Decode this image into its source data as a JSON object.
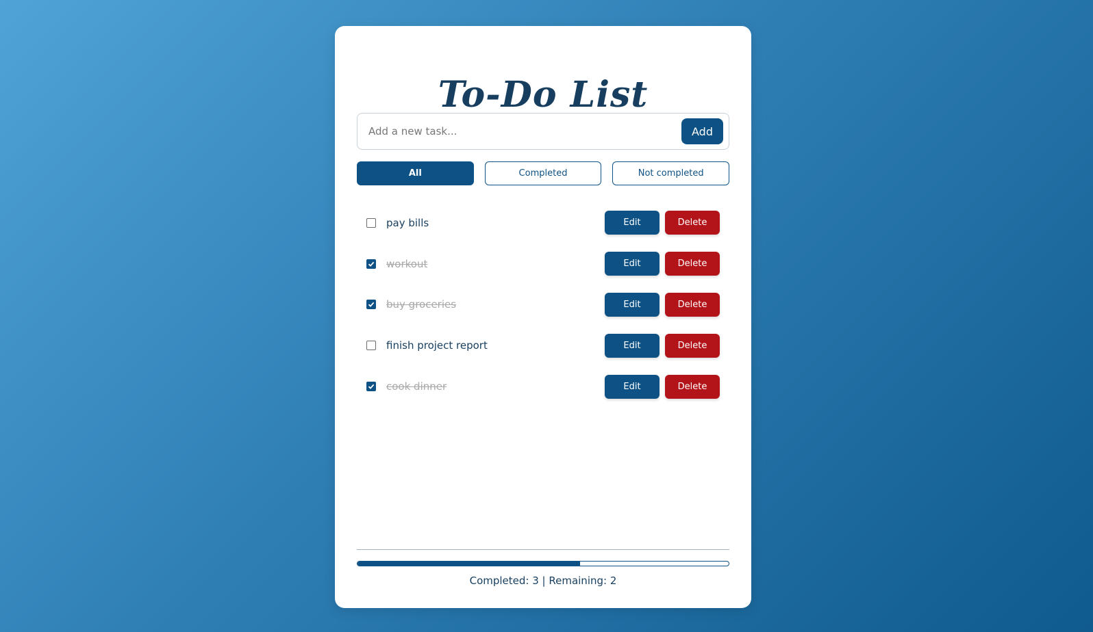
{
  "app": {
    "title": "To-Do List"
  },
  "input": {
    "placeholder": "Add a new task...",
    "value": "",
    "add_label": "Add"
  },
  "filters": [
    {
      "label": "All",
      "active": true
    },
    {
      "label": "Completed",
      "active": false
    },
    {
      "label": "Not completed",
      "active": false
    }
  ],
  "tasks": [
    {
      "text": "pay bills",
      "done": false
    },
    {
      "text": "workout",
      "done": true
    },
    {
      "text": "buy groceries",
      "done": true
    },
    {
      "text": "finish project report",
      "done": false
    },
    {
      "text": "cook dinner",
      "done": true
    }
  ],
  "task_actions": {
    "edit_label": "Edit",
    "delete_label": "Delete"
  },
  "progress": {
    "completed_fraction": 0.6
  },
  "stats": {
    "text": "Completed: 3 | Remaining: 2"
  },
  "colors": {
    "primary": "#0e5285",
    "danger": "#b3141a",
    "text": "#173e5e",
    "done_text": "#a8a8a8"
  }
}
